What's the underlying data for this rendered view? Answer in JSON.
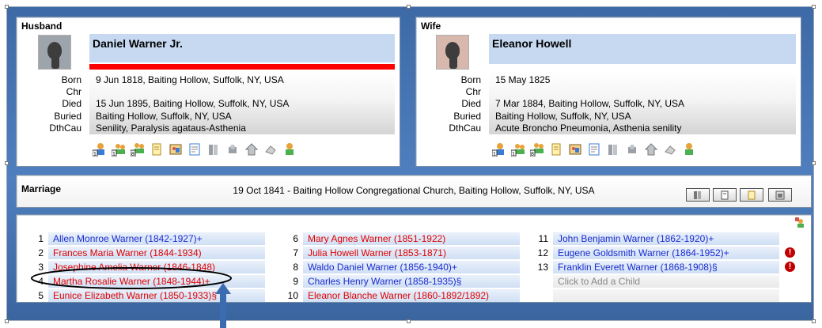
{
  "husband": {
    "title": "Husband",
    "name": "Daniel Warner Jr.",
    "labels": [
      "Born",
      "Chr",
      "Died",
      "Buried",
      "DthCau"
    ],
    "born": "9 Jun 1818, Baiting Hollow, Suffolk, NY, USA",
    "chr": "",
    "died": "15 Jun 1895, Baiting Hollow, Suffolk, NY, USA",
    "buried": "Baiting Hollow, Suffolk, NY, USA",
    "dthcau": "Senility, Paralysis agataus-Asthenia",
    "toolbar_numbers": [
      "1",
      "1",
      "8"
    ]
  },
  "wife": {
    "title": "Wife",
    "name": "Eleanor Howell",
    "labels": [
      "Born",
      "Chr",
      "Died",
      "Buried",
      "DthCau"
    ],
    "born": "15 May 1825",
    "chr": "",
    "died": "7 Mar 1884, Baiting Hollow, Suffolk, NY, USA",
    "buried": "Baiting Hollow, Suffolk, NY, USA",
    "dthcau": "Acute Broncho Pneumonia, Asthenia senility",
    "toolbar_numbers": [
      "1",
      "1",
      "8"
    ]
  },
  "marriage": {
    "title": "Marriage",
    "details": "19 Oct 1841 - Baiting Hollow Congregational Church, Baiting Hollow, Suffolk, NY, USA"
  },
  "children": {
    "column1": [
      {
        "num": "1",
        "name": "Allen Monroe Warner (1842-1927)+",
        "sex": "male"
      },
      {
        "num": "2",
        "name": "Frances Maria Warner (1844-1934)",
        "sex": "female"
      },
      {
        "num": "3",
        "name": "Josephine Amelia Warner (1846-1848)",
        "sex": "female"
      },
      {
        "num": "4",
        "name": "Martha Rosalie Warner (1848-1944)+",
        "sex": "female"
      },
      {
        "num": "5",
        "name": "Eunice Elizabeth Warner (1850-1933)§",
        "sex": "female"
      }
    ],
    "column2": [
      {
        "num": "6",
        "name": "Mary Agnes Warner (1851-1922)",
        "sex": "female"
      },
      {
        "num": "7",
        "name": "Julia Howell Warner (1853-1871)",
        "sex": "female"
      },
      {
        "num": "8",
        "name": "Waldo Daniel Warner (1856-1940)+",
        "sex": "male"
      },
      {
        "num": "9",
        "name": "Charles Henry Warner (1858-1935)§",
        "sex": "male"
      },
      {
        "num": "10",
        "name": "Eleanor Blanche Warner (1860-1892/1892)",
        "sex": "female"
      }
    ],
    "column3": [
      {
        "num": "11",
        "name": "John Benjamin Warner (1862-1920)+",
        "sex": "male"
      },
      {
        "num": "12",
        "name": "Eugene Goldsmith Warner (1864-1952)+",
        "sex": "male",
        "alert": "!"
      },
      {
        "num": "13",
        "name": "Franklin Everett Warner (1868-1908)§",
        "sex": "male",
        "alert": "!"
      }
    ],
    "add_child": "Click to Add a Child"
  },
  "colors": {
    "frame": "#4f7fbf",
    "namebar": "#c6d9f1",
    "male_text": "#1a2bd0",
    "female_text": "#e00000",
    "annotation": "#000000",
    "arrow": "#3b6cb0"
  }
}
